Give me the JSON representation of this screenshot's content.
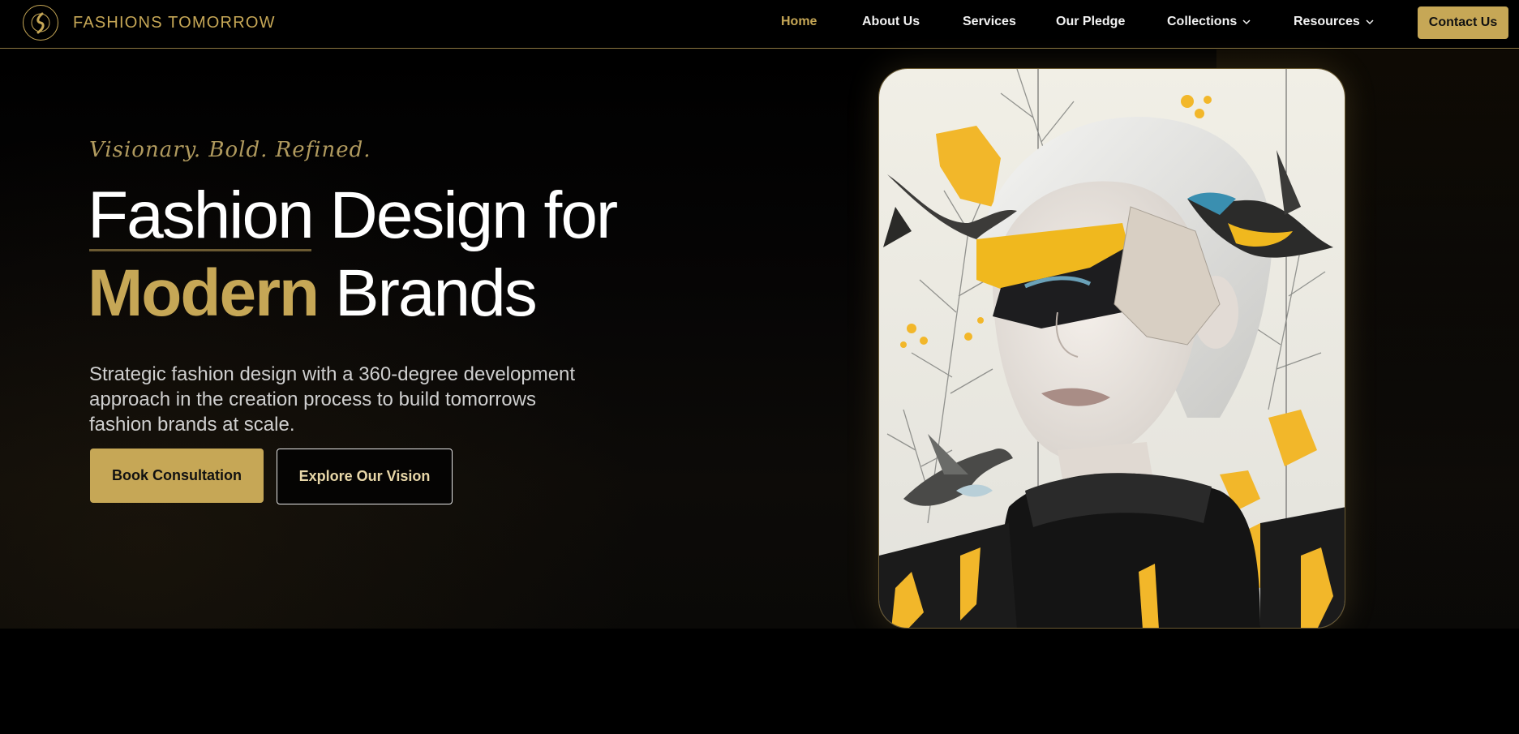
{
  "header": {
    "brand": "FASHIONS TOMORROW",
    "logo_icon": "brand-logo-icon",
    "nav": [
      {
        "label": "Home",
        "active": true
      },
      {
        "label": "About Us"
      },
      {
        "label": "Services"
      },
      {
        "label": "Our Pledge"
      },
      {
        "label": "Collections",
        "has_dropdown": true
      },
      {
        "label": "Resources",
        "has_dropdown": true
      }
    ],
    "contact_label": "Contact Us"
  },
  "hero": {
    "tagline": "Visionary. Bold. Refined.",
    "headline": {
      "word1": "Fashion",
      "rest_line1": " Design for",
      "word_gold": "Modern",
      "rest_line2": " Brands"
    },
    "description": "Strategic fashion design with a 360-degree development approach in the creation process to build tomorrows fashion brands at scale.",
    "primary_button": "Book Consultation",
    "secondary_button": "Explore Our Vision",
    "image_description": "collage-portrait"
  },
  "colors": {
    "accent_gold": "#c6a756",
    "background": "#000000",
    "text_light": "#f2f2f2"
  }
}
